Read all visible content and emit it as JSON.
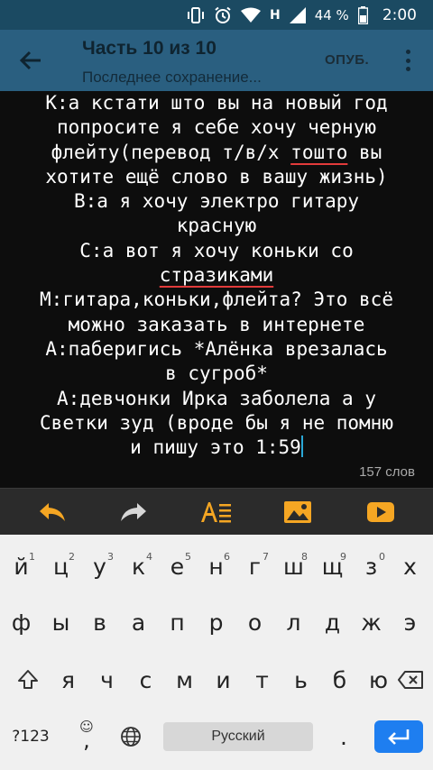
{
  "status_bar": {
    "network": "H",
    "battery": "44 %",
    "time": "2:00"
  },
  "app_bar": {
    "title": "Часть 10 из 10",
    "subtitle": "Последнее сохранение...",
    "publish_label": "ОПУБ."
  },
  "editor": {
    "lines": [
      "К:а кстати што вы на новый год",
      "попросите я себе хочу черную",
      "флейту(перевод т/в/х ",
      "тошто",
      " вы",
      "хотите ещё слово в вашу жизнь)",
      "В:а я хочу электро гитару",
      "красную",
      "С:а вот я хочу коньки со",
      "стразиками",
      "М:гитара,коньки,флейта? Это всё",
      "можно заказать в интернете",
      "А:паберигись *Алёнка врезалась",
      "в сугроб*",
      "А:девчонки Ирка заболела а у",
      "Светки зуд (вроде бы я не помню",
      "и пишу это 1:59"
    ],
    "word_count": "157 слов"
  },
  "toolbar": {
    "icons": [
      "undo-icon",
      "redo-icon",
      "text-format-icon",
      "image-icon",
      "video-icon"
    ],
    "accent_color": "#f5a623"
  },
  "keyboard": {
    "row1": [
      {
        "k": "й",
        "h": "1"
      },
      {
        "k": "ц",
        "h": "2"
      },
      {
        "k": "у",
        "h": "3"
      },
      {
        "k": "к",
        "h": "4"
      },
      {
        "k": "е",
        "h": "5"
      },
      {
        "k": "н",
        "h": "6"
      },
      {
        "k": "г",
        "h": "7"
      },
      {
        "k": "ш",
        "h": "8"
      },
      {
        "k": "щ",
        "h": "9"
      },
      {
        "k": "з",
        "h": "0"
      },
      {
        "k": "х",
        "h": ""
      }
    ],
    "row2": [
      "ф",
      "ы",
      "в",
      "а",
      "п",
      "р",
      "о",
      "л",
      "д",
      "ж",
      "э"
    ],
    "row3": [
      "я",
      "ч",
      "с",
      "м",
      "и",
      "т",
      "ь",
      "б",
      "ю"
    ],
    "symbols_label": "?123",
    "comma": ",",
    "period": ".",
    "space_label": "Русский",
    "enter_color": "#1e7ef0"
  }
}
